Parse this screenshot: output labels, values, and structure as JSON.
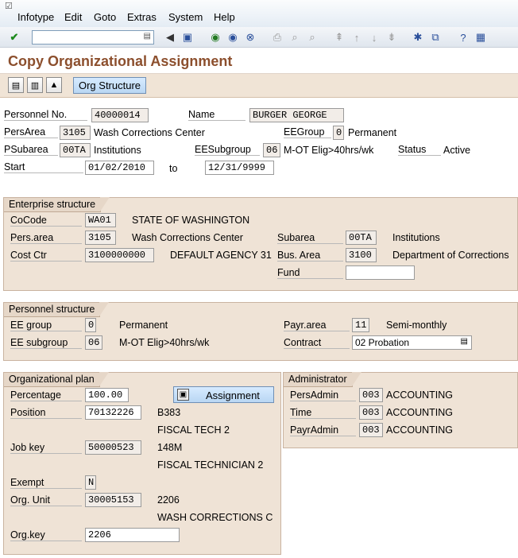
{
  "menu": [
    "Infotype",
    "Edit",
    "Goto",
    "Extras",
    "System",
    "Help"
  ],
  "toolbar": {
    "command_placeholder": ""
  },
  "title": "Copy Organizational Assignment",
  "appbar": {
    "org_structure_label": "Org Structure"
  },
  "header": {
    "personnel_no_label": "Personnel No.",
    "personnel_no": "40000014",
    "name_label": "Name",
    "name": "BURGER GEORGE",
    "persarea_label": "PersArea",
    "persarea_code": "3105",
    "persarea_text": "Wash Corrections Center",
    "eegroup_label": "EEGroup",
    "eegroup_code": "0",
    "eegroup_text": "Permanent",
    "psubarea_label": "PSubarea",
    "psubarea_code": "00TA",
    "psubarea_text": "Institutions",
    "eesubgroup_label": "EESubgroup",
    "eesubgroup_code": "06",
    "eesubgroup_text": "M-OT Elig>40hrs/wk",
    "status_label": "Status",
    "status_text": "Active",
    "start_label": "Start",
    "start_date": "01/02/2010",
    "to_label": "to",
    "end_date": "12/31/9999"
  },
  "enterprise": {
    "title": "Enterprise structure",
    "cocode_label": "CoCode",
    "cocode": "WA01",
    "cocode_text": "STATE OF WASHINGTON",
    "persarea_label": "Pers.area",
    "persarea": "3105",
    "persarea_text": "Wash Corrections Center",
    "subarea_label": "Subarea",
    "subarea": "00TA",
    "subarea_text": "Institutions",
    "costctr_label": "Cost Ctr",
    "costctr": "3100000000",
    "costctr_text": "DEFAULT AGENCY 31",
    "busarea_label": "Bus. Area",
    "busarea": "3100",
    "busarea_text": "Department of Corrections",
    "fund_label": "Fund",
    "fund": ""
  },
  "personnel": {
    "title": "Personnel structure",
    "eegroup_label": "EE group",
    "eegroup": "0",
    "eegroup_text": "Permanent",
    "payrarea_label": "Payr.area",
    "payrarea": "11",
    "payrarea_text": "Semi-monthly",
    "eesubgroup_label": "EE subgroup",
    "eesubgroup": "06",
    "eesubgroup_text": "M-OT Elig>40hrs/wk",
    "contract_label": "Contract",
    "contract": "02 Probation"
  },
  "orgplan": {
    "title": "Organizational plan",
    "percentage_label": "Percentage",
    "percentage": "100.00",
    "assignment_label": "Assignment",
    "position_label": "Position",
    "position": "70132226",
    "position_short": "B383",
    "position_text": "FISCAL TECH 2",
    "jobkey_label": "Job key",
    "jobkey": "50000523",
    "jobkey_short": "148M",
    "jobkey_text": "FISCAL TECHNICIAN 2",
    "exempt_label": "Exempt",
    "exempt": "N",
    "orgunit_label": "Org. Unit",
    "orgunit": "30005153",
    "orgunit_short": "2206",
    "orgunit_text": "WASH CORRECTIONS C",
    "orgkey_label": "Org.key",
    "orgkey": "2206"
  },
  "admin": {
    "title": "Administrator",
    "persadmin_label": "PersAdmin",
    "persadmin": "003",
    "persadmin_text": "ACCOUNTING",
    "time_label": "Time",
    "time": "003",
    "time_text": "ACCOUNTING",
    "payradmin_label": "PayrAdmin",
    "payradmin": "003",
    "payradmin_text": "ACCOUNTING"
  }
}
